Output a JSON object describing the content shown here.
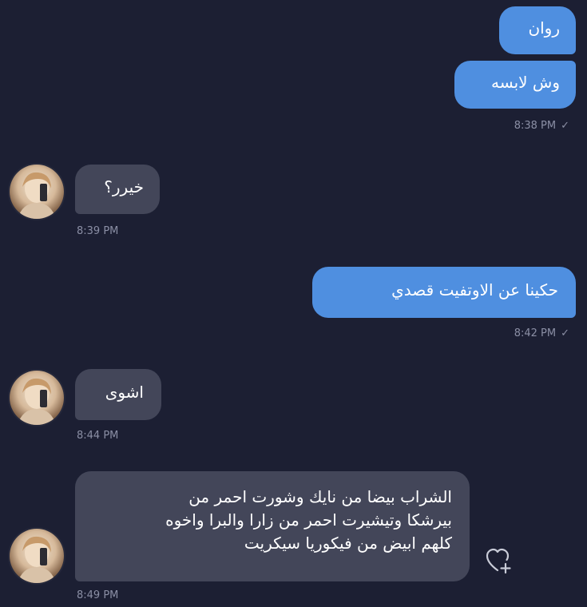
{
  "messages": [
    {
      "id": "m1",
      "direction": "out",
      "text": "روان"
    },
    {
      "id": "m2",
      "direction": "out",
      "text": "وش لابسه"
    },
    {
      "id": "m3",
      "direction": "in",
      "text": "خيرر؟"
    },
    {
      "id": "m4",
      "direction": "out",
      "text": "حكينا عن الاوتفيت قصدي"
    },
    {
      "id": "m5",
      "direction": "in",
      "text": "اشوى"
    },
    {
      "id": "m6",
      "direction": "in",
      "lines": [
        "الشراب بيضا من نايك وشورت احمر من",
        "بيرشكا وتيشيرت احمر من زارا والبرا واخوه",
        "كلهم ابيض من فيكوريا سيكريت"
      ]
    }
  ],
  "timestamps": {
    "t1": "8:38 PM",
    "t2": "8:39 PM",
    "t3": "8:42 PM",
    "t4": "8:44 PM",
    "t5": "8:49 PM"
  },
  "read_check": "✓",
  "icons": {
    "avatar": "avatar-icon",
    "react": "heart-plus-icon"
  },
  "colors": {
    "background": "#1c1f33",
    "outgoing_bubble": "#4f8fe0",
    "incoming_bubble": "#434659",
    "timestamp": "#8b8fa5"
  }
}
